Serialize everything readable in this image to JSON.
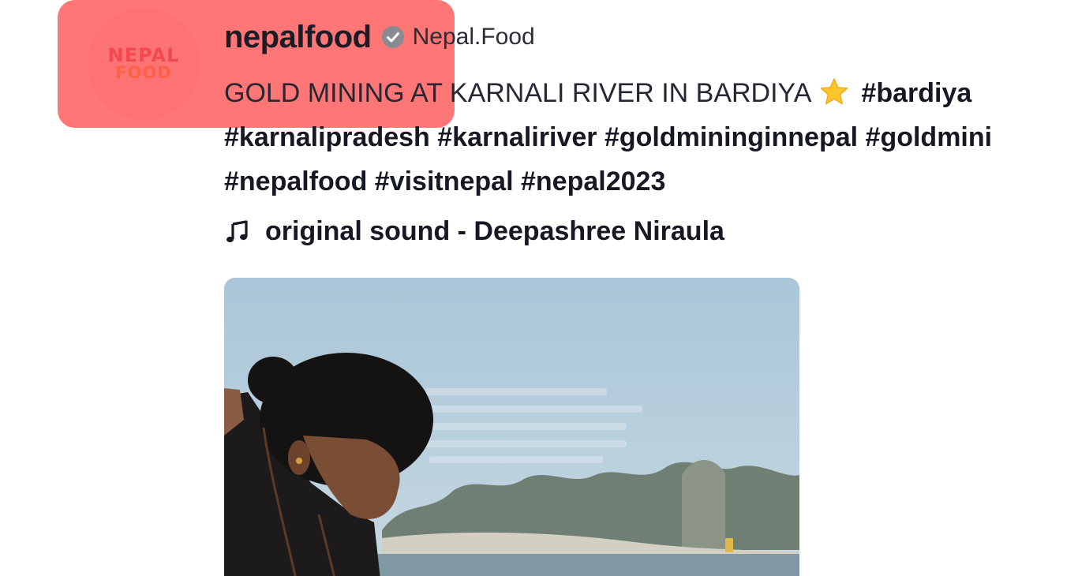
{
  "author": {
    "username": "nepalfood",
    "nickname": "Nepal.Food",
    "verified": true,
    "avatar_logo": {
      "line1": "NEPAL",
      "line2": "FOOD"
    }
  },
  "caption": {
    "line1_text": "GOLD MINING AT KARNALI RIVER IN BARDIYA",
    "line1_emoji": "star-icon",
    "line1_tags": [
      "#bardiya"
    ],
    "line2_tags": [
      "#karnalipradesh",
      "#karnaliriver",
      "#goldmininginnepal",
      "#goldmini"
    ],
    "line3_tags": [
      "#nepalfood",
      "#visitnepal",
      "#nepal2023"
    ]
  },
  "music": {
    "icon": "music-note-icon",
    "label": "original sound - Deepashree Niraula"
  },
  "video": {
    "thumbnail_description": "woman bending near river bank"
  },
  "colors": {
    "highlight": "#ff5050",
    "text": "#161823",
    "verified": "#8a8b91",
    "star": "#fcc52b"
  }
}
